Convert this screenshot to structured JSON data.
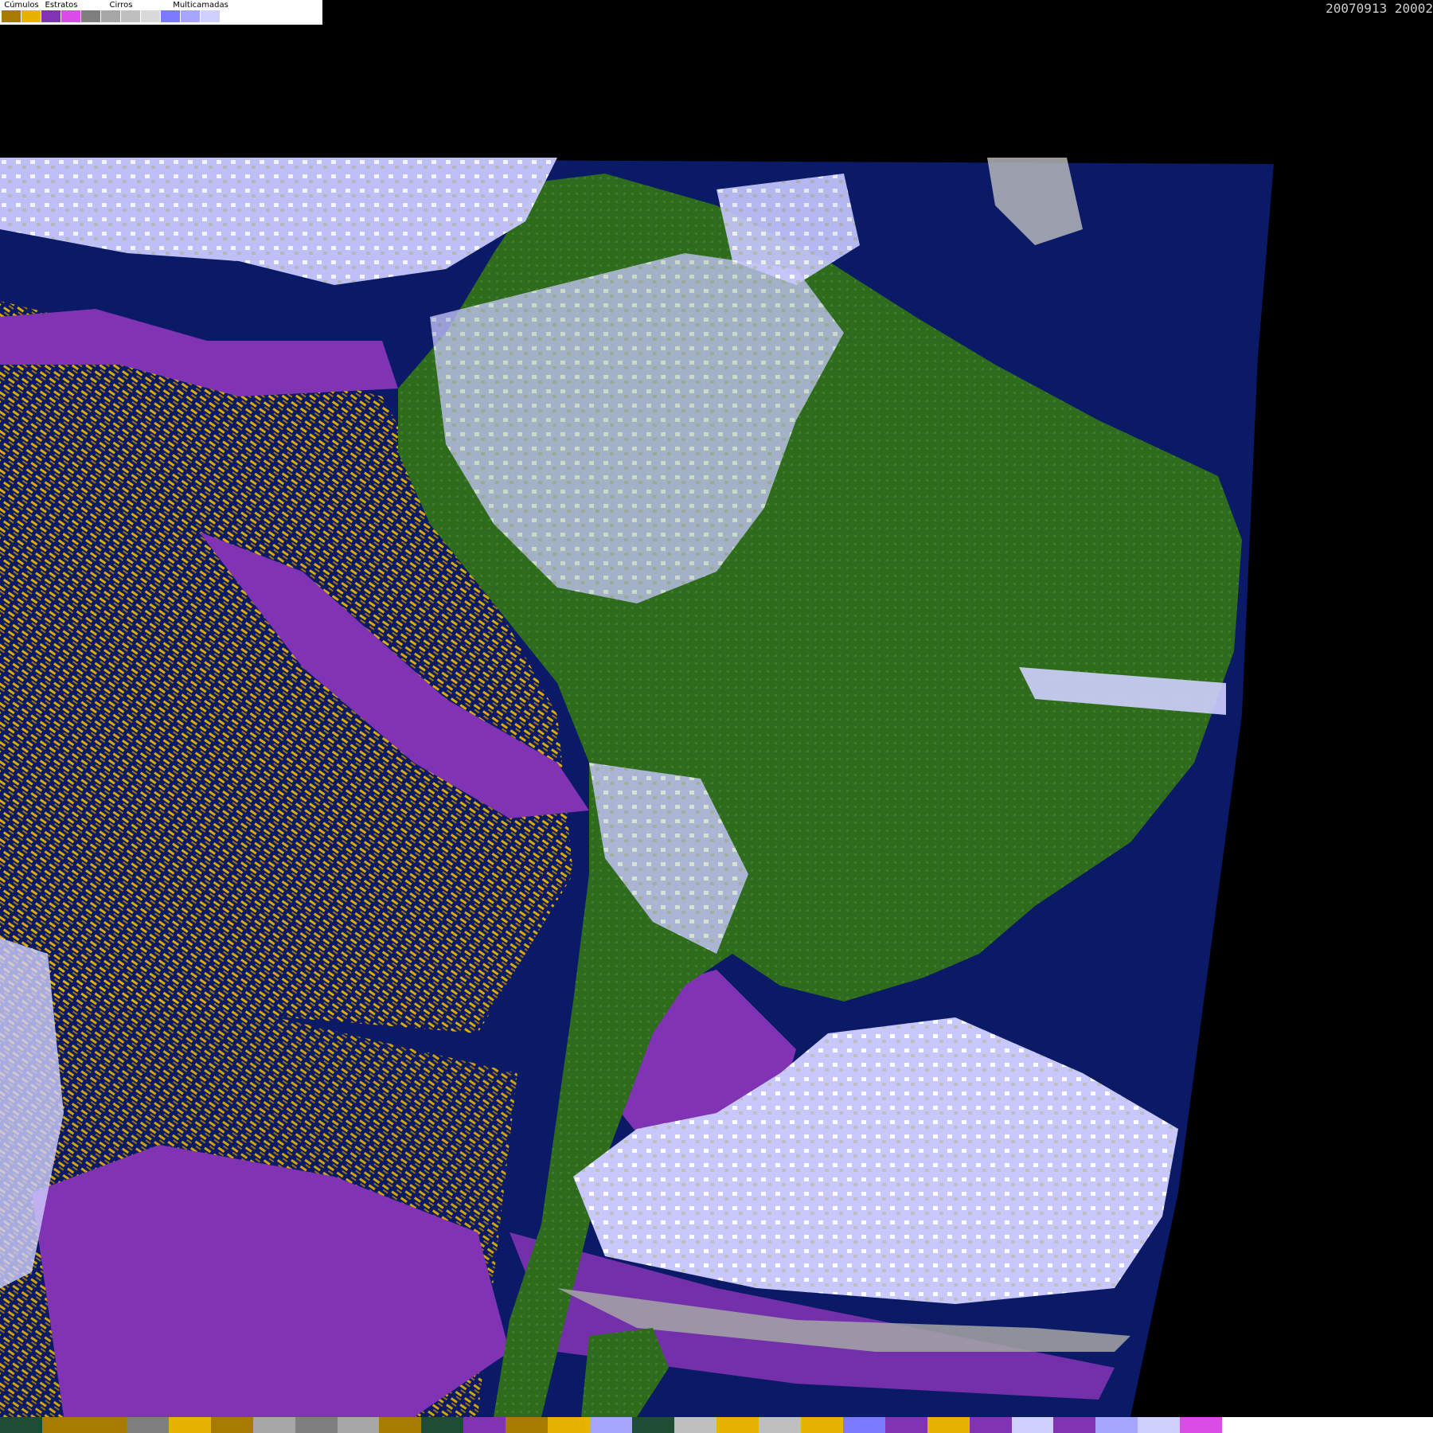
{
  "timestamp": "20070913 20002",
  "legend": {
    "groups": [
      {
        "label": "Cúmulos",
        "swatches": [
          "#a77a00",
          "#e6b400"
        ]
      },
      {
        "label": "Estratos",
        "swatches": [
          "#8033b3",
          "#d94de6"
        ]
      },
      {
        "label": "Cirros",
        "swatches": [
          "#7f7f7f",
          "#a6a6a6",
          "#bfbfbf",
          "#d9d9d9"
        ]
      },
      {
        "label": "Multicamadas",
        "swatches": [
          "#7a7aff",
          "#a6a6ff",
          "#d0d0ff",
          "#ffffff"
        ]
      }
    ]
  },
  "colors": {
    "ocean": "#0a1a66",
    "land": "#2f6b1c",
    "cumulus_low": "#a77a00",
    "cumulus_high": "#e6b400",
    "stratus": "#8033b3",
    "stratus_light": "#d94de6",
    "multilayer": "#c8c8ff",
    "background": "#000000"
  },
  "bottom_strip": [
    "#1f4d33",
    "#a77a00",
    "#a77a00",
    "#7f7f7f",
    "#e6b400",
    "#a77a00",
    "#a6a6a6",
    "#7f7f7f",
    "#a6a6a6",
    "#a77a00",
    "#1f4d33",
    "#8033b3",
    "#a77a00",
    "#e6b400",
    "#a6a6ff",
    "#1f4d33",
    "#bfbfbf",
    "#e6b400",
    "#bfbfbf",
    "#e6b400",
    "#7a7aff",
    "#8033b3",
    "#e6b400",
    "#8033b3",
    "#d0d0ff",
    "#8033b3",
    "#a6a6ff",
    "#d0d0ff",
    "#d94de6",
    "#ffffff",
    "#ffffff",
    "#ffffff",
    "#ffffff",
    "#ffffff"
  ]
}
